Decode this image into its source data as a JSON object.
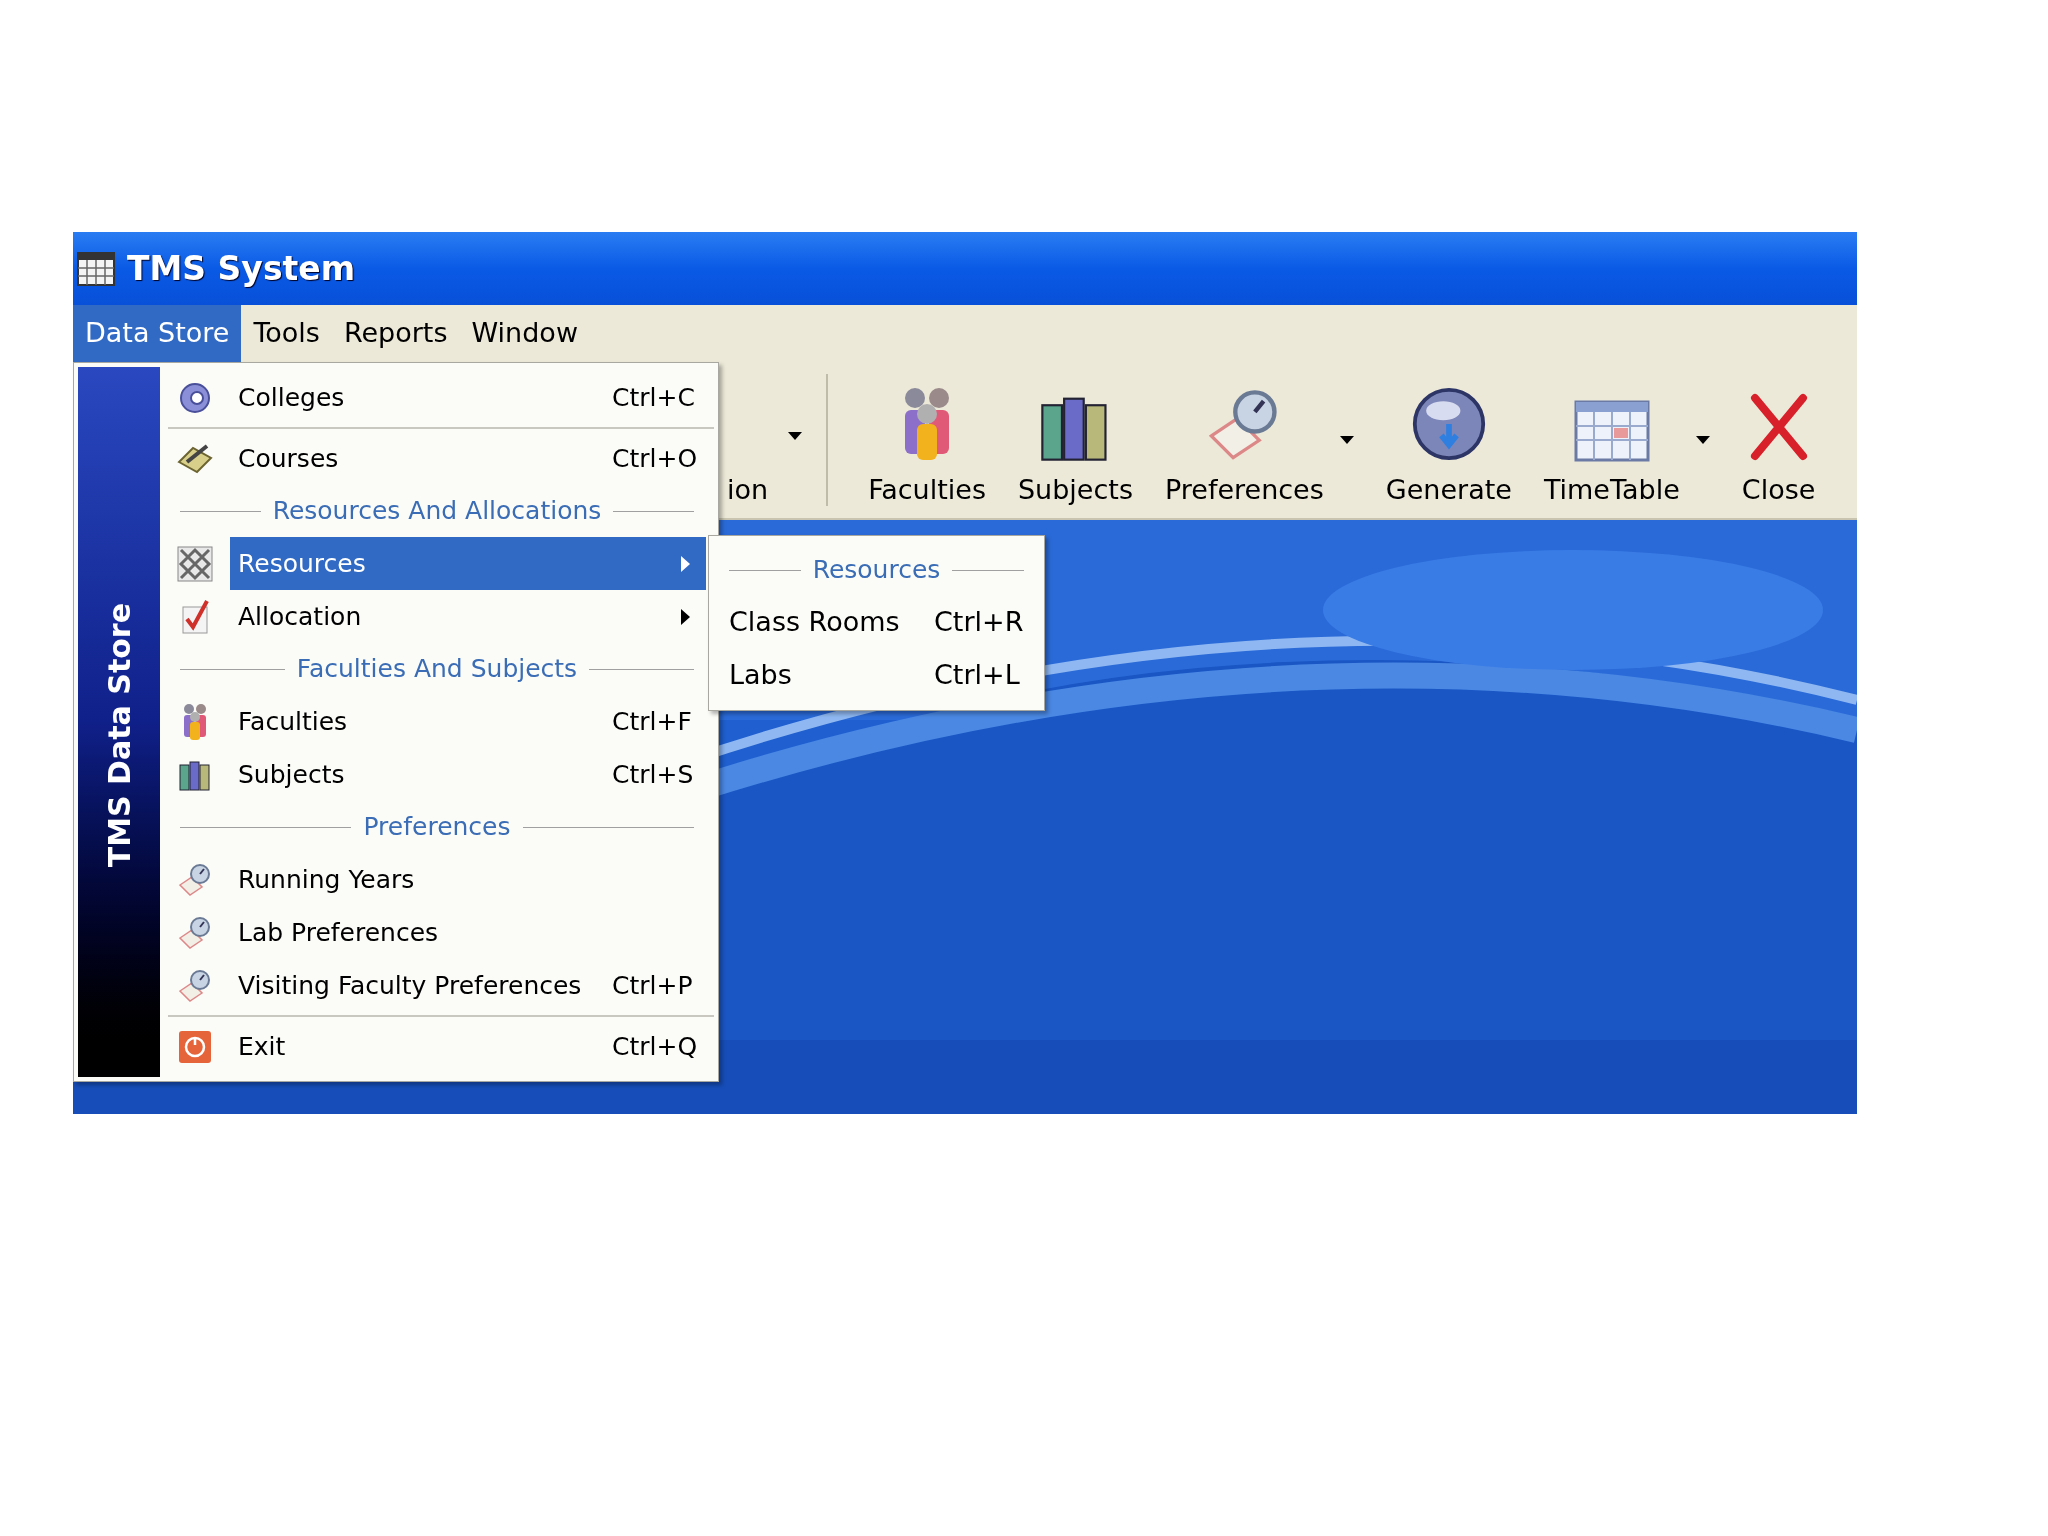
{
  "window": {
    "title": "TMS System"
  },
  "menubar": [
    {
      "label": "Data Store",
      "selected": true
    },
    {
      "label": "Tools",
      "selected": false
    },
    {
      "label": "Reports",
      "selected": false
    },
    {
      "label": "Window",
      "selected": false
    }
  ],
  "toolbar": [
    {
      "kind": "partial",
      "label": "ion",
      "dropdown": true
    },
    {
      "kind": "separator"
    },
    {
      "kind": "button",
      "label": "Faculties",
      "dropdown": false
    },
    {
      "kind": "button",
      "label": "Subjects",
      "dropdown": false
    },
    {
      "kind": "button",
      "label": "Preferences",
      "dropdown": true
    },
    {
      "kind": "button",
      "label": "Generate",
      "dropdown": false
    },
    {
      "kind": "button",
      "label": "TimeTable",
      "dropdown": true
    },
    {
      "kind": "button",
      "label": "Close",
      "dropdown": false
    }
  ],
  "menu": {
    "sidebar_title": "TMS Data Store",
    "items": [
      {
        "kind": "item",
        "label": "Colleges",
        "shortcut": "Ctrl+C",
        "selected": false,
        "submenu": false
      },
      {
        "kind": "separator"
      },
      {
        "kind": "item",
        "label": "Courses",
        "shortcut": "Ctrl+O",
        "selected": false,
        "submenu": false
      },
      {
        "kind": "header",
        "label": "Resources And Allocations"
      },
      {
        "kind": "item",
        "label": "Resources",
        "selected": true,
        "submenu": true
      },
      {
        "kind": "item",
        "label": "Allocation",
        "selected": false,
        "submenu": true
      },
      {
        "kind": "header",
        "label": "Faculties And Subjects"
      },
      {
        "kind": "item",
        "label": "Faculties",
        "shortcut": "Ctrl+F",
        "selected": false,
        "submenu": false
      },
      {
        "kind": "item",
        "label": "Subjects",
        "shortcut": "Ctrl+S",
        "selected": false,
        "submenu": false
      },
      {
        "kind": "header",
        "label": "Preferences"
      },
      {
        "kind": "item",
        "label": "Running Years",
        "selected": false,
        "submenu": false
      },
      {
        "kind": "item",
        "label": "Lab Preferences",
        "selected": false,
        "submenu": false
      },
      {
        "kind": "item",
        "label": "Visiting Faculty Preferences",
        "shortcut": "Ctrl+P",
        "selected": false,
        "submenu": false
      },
      {
        "kind": "separator"
      },
      {
        "kind": "item",
        "label": "Exit",
        "shortcut": "Ctrl+Q",
        "selected": false,
        "submenu": false
      }
    ]
  },
  "submenu": {
    "items": [
      {
        "kind": "header",
        "label": "Resources"
      },
      {
        "kind": "item",
        "label": "Class Rooms",
        "shortcut": "Ctrl+R",
        "selected": false
      },
      {
        "kind": "item",
        "label": "Labs",
        "shortcut": "Ctrl+L",
        "selected": false
      }
    ]
  }
}
